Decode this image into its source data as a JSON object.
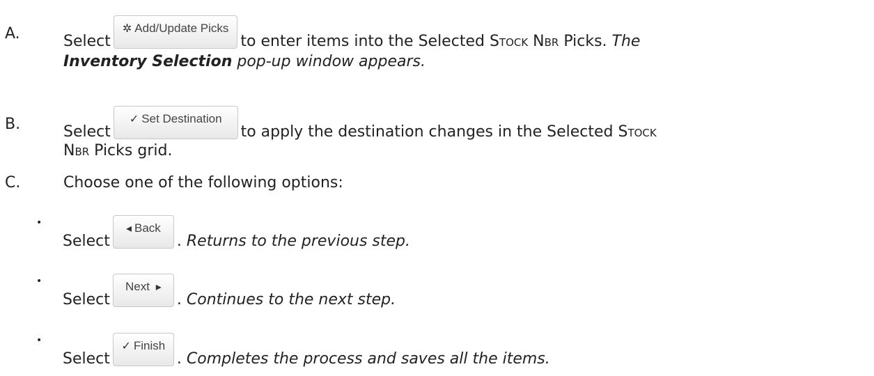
{
  "items": {
    "a": {
      "marker": "A.",
      "pre": "Select",
      "button": {
        "label": "Add/Update Picks",
        "icon": "gear-icon",
        "glyph": "✲"
      },
      "post1": "to enter items into the Selected ",
      "stock": "Stock Nbr",
      "post2": " Picks. ",
      "it1": "The",
      "bold": "Inventory Selection",
      "it2": " pop-up window appears."
    },
    "b": {
      "marker": "B.",
      "pre": "Select",
      "button": {
        "label": "Set Destination",
        "icon": "checkmark-icon",
        "glyph": "✓"
      },
      "post1": "to apply the destination changes in the Selected ",
      "stock": "Stock",
      "nbr": "Nbr",
      "post2": " Picks grid."
    },
    "c": {
      "marker": "C.",
      "text": "Choose one of the following options:"
    }
  },
  "options": [
    {
      "pre": "Select",
      "label": "Back",
      "icon": "back-arrow-icon",
      "glyph": "◂",
      "desc": "Returns to the previous step."
    },
    {
      "pre": "Select",
      "label": "Next",
      "icon": "next-arrow-icon",
      "glyph": "▸",
      "desc": "Continues to the next step."
    },
    {
      "pre": "Select",
      "label": "Finish",
      "icon": "checkmark-icon",
      "glyph": "✓",
      "desc": "Completes the process and saves all the items."
    }
  ],
  "bullet_glyph": "•",
  "period": "."
}
